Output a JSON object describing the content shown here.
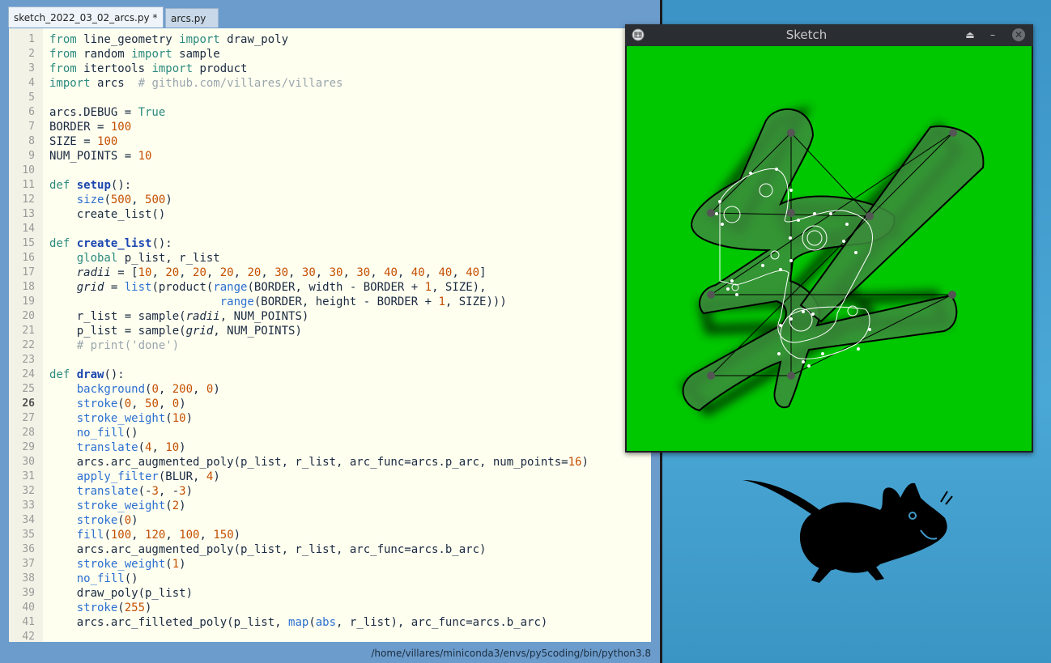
{
  "editor": {
    "tabs": [
      {
        "label": "sketch_2022_03_02_arcs.py *",
        "close": "×"
      },
      {
        "label": "arcs.py",
        "close": "×"
      }
    ],
    "status_path": "/home/villares/miniconda3/envs/py5coding/bin/python3.8",
    "current_line": 26,
    "lines": [
      {
        "n": "1",
        "html": "<span class='kw'>from</span> line_geometry <span class='kw'>import</span> draw_poly"
      },
      {
        "n": "2",
        "html": "<span class='kw'>from</span> random <span class='kw'>import</span> sample"
      },
      {
        "n": "3",
        "html": "<span class='kw'>from</span> itertools <span class='kw'>import</span> product"
      },
      {
        "n": "4",
        "html": "<span class='kw'>import</span> arcs  <span class='cm'># github.com/villares/villares</span>"
      },
      {
        "n": "5",
        "html": ""
      },
      {
        "n": "6",
        "html": "arcs.DEBUG = <span class='kw'>True</span>"
      },
      {
        "n": "7",
        "html": "BORDER = <span class='num'>100</span>"
      },
      {
        "n": "8",
        "html": "SIZE = <span class='num'>100</span>"
      },
      {
        "n": "9",
        "html": "NUM_POINTS = <span class='num'>10</span>"
      },
      {
        "n": "10",
        "html": ""
      },
      {
        "n": "11",
        "html": "<span class='kw'>def</span> <span class='fn'>setup</span>():"
      },
      {
        "n": "12",
        "html": "    <span class='bi'>size</span>(<span class='num'>500</span>, <span class='num'>500</span>)"
      },
      {
        "n": "13",
        "html": "    create_list()"
      },
      {
        "n": "14",
        "html": ""
      },
      {
        "n": "15",
        "html": "<span class='kw'>def</span> <span class='fn'>create_list</span>():"
      },
      {
        "n": "16",
        "html": "    <span class='kw'>global</span> p_list, r_list"
      },
      {
        "n": "17",
        "html": "    <span class='it'>radii</span> = [<span class='num'>10</span>, <span class='num'>20</span>, <span class='num'>20</span>, <span class='num'>20</span>, <span class='num'>20</span>, <span class='num'>30</span>, <span class='num'>30</span>, <span class='num'>30</span>, <span class='num'>30</span>, <span class='num'>40</span>, <span class='num'>40</span>, <span class='num'>40</span>, <span class='num'>40</span>]"
      },
      {
        "n": "18",
        "html": "    <span class='it'>grid</span> = <span class='bi'>list</span>(product(<span class='bi'>range</span>(BORDER, width - BORDER + <span class='num'>1</span>, SIZE),"
      },
      {
        "n": "19",
        "html": "                         <span class='bi'>range</span>(BORDER, height - BORDER + <span class='num'>1</span>, SIZE)))"
      },
      {
        "n": "20",
        "html": "    r_list = sample(<span class='it'>radii</span>, NUM_POINTS)"
      },
      {
        "n": "21",
        "html": "    p_list = sample(<span class='it'>grid</span>, NUM_POINTS)"
      },
      {
        "n": "22",
        "html": "    <span class='cm'># print('done')</span>"
      },
      {
        "n": "23",
        "html": ""
      },
      {
        "n": "24",
        "html": "<span class='kw'>def</span> <span class='fn'>draw</span>():"
      },
      {
        "n": "25",
        "html": "    <span class='bi'>background</span>(<span class='num'>0</span>, <span class='num'>200</span>, <span class='num'>0</span>)"
      },
      {
        "n": "26",
        "html": "    <span class='bi'>stroke</span>(<span class='num'>0</span>, <span class='num'>50</span>, <span class='num'>0</span>)"
      },
      {
        "n": "27",
        "html": "    <span class='bi'>stroke_weight</span>(<span class='num'>10</span>)"
      },
      {
        "n": "28",
        "html": "    <span class='bi'>no_fill</span>()"
      },
      {
        "n": "29",
        "html": "    <span class='bi'>translate</span>(<span class='num'>4</span>, <span class='num'>10</span>)"
      },
      {
        "n": "30",
        "html": "    arcs.arc_augmented_poly(p_list, r_list, arc_func=arcs.p_arc, num_points=<span class='num'>16</span>)"
      },
      {
        "n": "31",
        "html": "    <span class='bi'>apply_filter</span>(BLUR, <span class='num'>4</span>)"
      },
      {
        "n": "32",
        "html": "    <span class='bi'>translate</span>(-<span class='num'>3</span>, -<span class='num'>3</span>)"
      },
      {
        "n": "33",
        "html": "    <span class='bi'>stroke_weight</span>(<span class='num'>2</span>)"
      },
      {
        "n": "34",
        "html": "    <span class='bi'>stroke</span>(<span class='num'>0</span>)"
      },
      {
        "n": "35",
        "html": "    <span class='bi'>fill</span>(<span class='num'>100</span>, <span class='num'>120</span>, <span class='num'>100</span>, <span class='num'>150</span>)"
      },
      {
        "n": "36",
        "html": "    arcs.arc_augmented_poly(p_list, r_list, arc_func=arcs.b_arc)"
      },
      {
        "n": "37",
        "html": "    <span class='bi'>stroke_weight</span>(<span class='num'>1</span>)"
      },
      {
        "n": "38",
        "html": "    <span class='bi'>no_fill</span>()"
      },
      {
        "n": "39",
        "html": "    draw_poly(p_list)"
      },
      {
        "n": "40",
        "html": "    <span class='bi'>stroke</span>(<span class='num'>255</span>)"
      },
      {
        "n": "41",
        "html": "    arcs.arc_filleted_poly(p_list, <span class='bi'>map</span>(<span class='bi'>abs</span>, r_list), arc_func=arcs.b_arc)"
      },
      {
        "n": "42",
        "html": ""
      }
    ]
  },
  "sketch_window": {
    "title": "Sketch",
    "buttons": {
      "shade": "⏏",
      "minimize": "–",
      "close": "✕"
    },
    "background_color": "#00c800"
  }
}
